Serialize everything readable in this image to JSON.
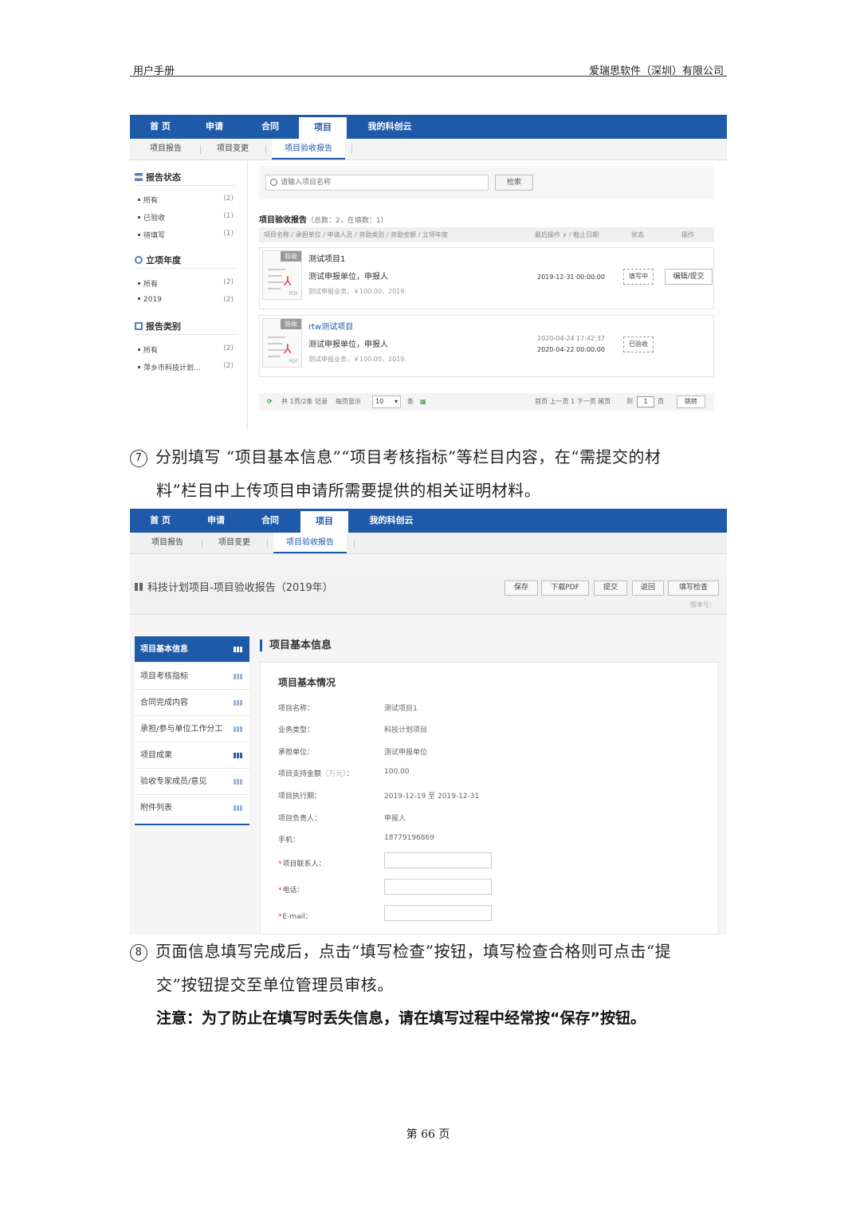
{
  "header": {
    "left": "用户手册",
    "right": "爱瑞思软件（深圳）有限公司"
  },
  "footer": "第 66 页",
  "nav": {
    "items": [
      "首 页",
      "申请",
      "合同",
      "项目",
      "我的科创云"
    ],
    "active_index": 3,
    "sub_items": [
      "项目报告",
      "项目变更",
      "项目验收报告"
    ],
    "sub_active_index": 2
  },
  "screenshot1": {
    "sidebar": {
      "sections": [
        {
          "title": "报告状态",
          "icon": "sitemap-icon",
          "rows": [
            [
              "所有",
              "(2)"
            ],
            [
              "已验收",
              "(1)"
            ],
            [
              "待填写",
              "(1)"
            ]
          ]
        },
        {
          "title": "立项年度",
          "icon": "clock-icon",
          "rows": [
            [
              "所有",
              "(2)"
            ],
            [
              "2019",
              "(2)"
            ]
          ]
        },
        {
          "title": "报告类别",
          "icon": "list-icon",
          "rows": [
            [
              "所有",
              "(2)"
            ],
            [
              "萍乡市科技计划...",
              "(2)"
            ]
          ]
        }
      ]
    },
    "search": {
      "placeholder": "请输入项目名称",
      "button": "检索"
    },
    "list": {
      "title": "项目验收报告",
      "summary": "（总数：2，在填数：1）",
      "columns": [
        "项目名称 / 承担单位 / 申请人员 / 资助类别 / 资助金额 / 立项年度",
        "最后操作 ∨ / 截止日期",
        "状态",
        "操作"
      ],
      "rows": [
        {
          "tag": "验收",
          "name": "测试项目1",
          "unit": "测试申报单位，申报人",
          "desc": "测试申报业务，￥100.00，2019.",
          "date1": "",
          "date2": "2019-12-31 00:00:00",
          "status": "填写中",
          "op": "编辑/提交"
        },
        {
          "tag": "验收",
          "name": "rtw测试项目",
          "unit": "测试申报单位，申报人",
          "desc": "测试申报业务，￥100.00，2019.",
          "date1": "2020-04-24 17:42:37",
          "date2": "2020-04-22 00:00:00",
          "status": "已验收",
          "op": ""
        }
      ]
    },
    "pager": {
      "total": "共 1页/2条 记录",
      "per_page_label": "每页显示",
      "per_page": "10",
      "unit": "条",
      "nav": "首页 上一页 1 下一页 尾页",
      "goto": "到",
      "page": "1",
      "page_unit": "页",
      "jump": "跳转"
    }
  },
  "para7": {
    "num": "7",
    "line1": "分别填写 “项目基本信息”“项目考核指标”等栏目内容，在“需提交的材",
    "line2": "料”栏目中上传项目申请所需要提供的相关证明材料。"
  },
  "screenshot2": {
    "form_title": "科技计划项目-项目验收报告（2019年）",
    "buttons": [
      "保存",
      "下载PDF",
      "提交",
      "返回",
      "填写检查"
    ],
    "code_label": "版本号:",
    "sidebar": [
      "项目基本信息",
      "项目考核指标",
      "合同完成内容",
      "承担/参与单位工作分工",
      "项目成果",
      "验收专家成员/意见",
      "附件列表"
    ],
    "section_title": "项目基本信息",
    "panel_title": "项目基本情况",
    "fields": [
      {
        "label": "项目名称：",
        "value": "测试项目1"
      },
      {
        "label": "业务类型：",
        "value": "科技计划项目"
      },
      {
        "label": "承担单位：",
        "value": "测试申报单位"
      },
      {
        "label": "项目支持金额",
        "unit": "（万元）",
        "colon": "：",
        "value": "100.00"
      },
      {
        "label": "项目执行期：",
        "value": "2019-12-19  至  2019-12-31"
      },
      {
        "label": "项目负责人：",
        "value": "申报人"
      },
      {
        "label": "手机：",
        "value": "18779196869"
      }
    ],
    "required_fields": [
      "项目联系人：",
      "电话：",
      "E-mail："
    ]
  },
  "para8": {
    "num": "8",
    "line1": "页面信息填写完成后，点击“填写检查”按钮，填写检查合格则可点击“提",
    "line2": "交”按钮提交至单位管理员审核。"
  },
  "note": "注意：为了防止在填写时丢失信息，请在填写过程中经常按“保存”按钮。"
}
